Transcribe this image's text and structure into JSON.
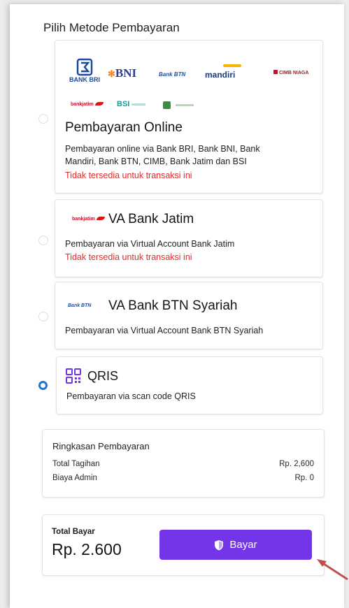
{
  "header": {
    "title": "Pilih Metode Pembayaran"
  },
  "methods": [
    {
      "title": "Pembayaran Online",
      "desc_line1": "Pembayaran online via Bank BRI, Bank BNI, Bank",
      "desc_line2": "Mandiri, Bank BTN, CIMB, Bank Jatim dan BSI",
      "warning": "Tidak tersedia untuk transaksi ini",
      "logos": {
        "bri_top": "BANK BRI",
        "bni": "BNI",
        "btn": "Bank BTN",
        "mandiri": "mandiri",
        "cimb": "CIMB NIAGA",
        "jatim": "bankjatim",
        "bsi": "BSI"
      }
    },
    {
      "title": "VA Bank Jatim",
      "desc": "Pembayaran via Virtual Account Bank Jatim",
      "warning": "Tidak tersedia untuk transaksi ini",
      "logo": "bankjatim"
    },
    {
      "title": "VA Bank BTN Syariah",
      "desc": "Pembayaran via Virtual Account Bank BTN Syariah",
      "logo": "Bank BTN"
    },
    {
      "title": "QRIS",
      "desc": "Pembayaran via scan code QRIS"
    }
  ],
  "summary": {
    "heading": "Ringkasan Pembayaran",
    "total_tagihan_label": "Total Tagihan",
    "total_tagihan_value": "Rp. 2,600",
    "biaya_admin_label": "Biaya Admin",
    "biaya_admin_value": "Rp. 0"
  },
  "footer": {
    "total_label": "Total Bayar",
    "total_value": "Rp. 2.600",
    "pay_button": "Bayar"
  },
  "colors": {
    "accent": "#7434e8",
    "radio_selected": "#1877d8",
    "warning": "#e52b2b",
    "annotation_arrow": "#c0504d"
  }
}
